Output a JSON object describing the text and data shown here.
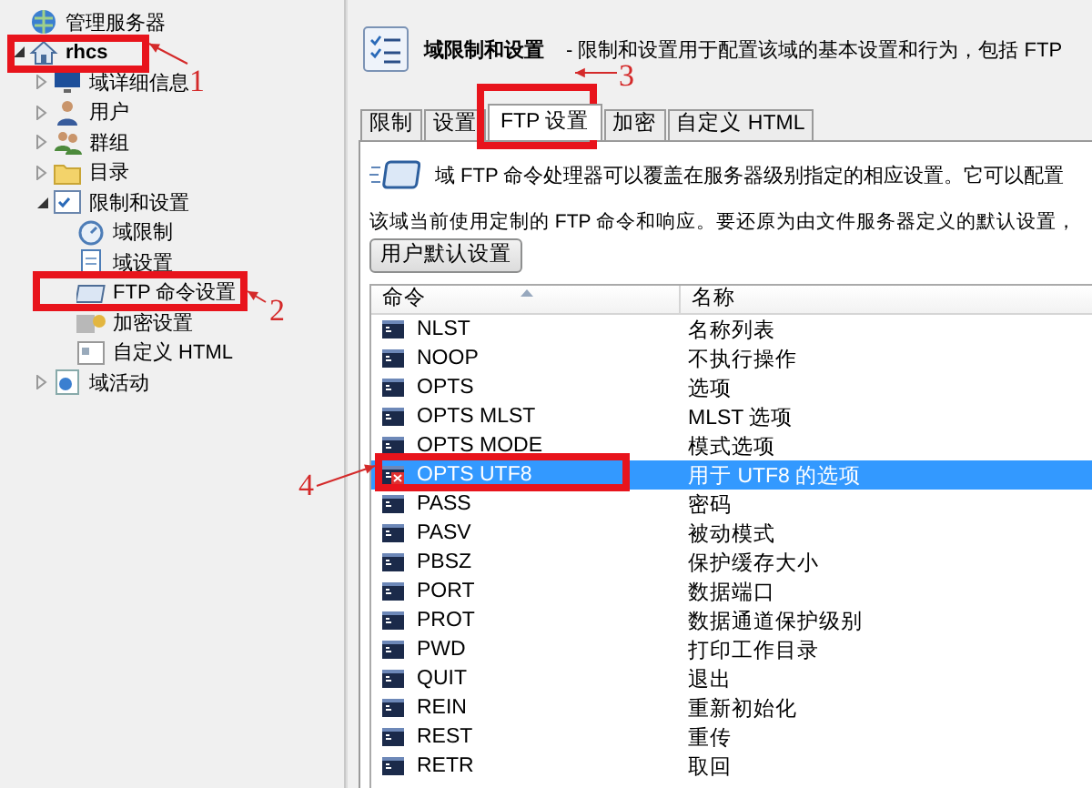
{
  "tree": [
    {
      "label": "管理服务器",
      "children": [
        {
          "label": "rhcs",
          "expanded": true,
          "children": [
            {
              "label": "域详细信息",
              "expanded": false
            },
            {
              "label": "用户",
              "expanded": false
            },
            {
              "label": "群组",
              "expanded": false
            },
            {
              "label": "目录",
              "expanded": false
            },
            {
              "label": "限制和设置",
              "expanded": true,
              "children": [
                {
                  "label": "域限制"
                },
                {
                  "label": "域设置"
                },
                {
                  "label": "FTP 命令设置"
                },
                {
                  "label": "加密设置"
                },
                {
                  "label": "自定义 HTML"
                }
              ]
            },
            {
              "label": "域活动",
              "expanded": false
            }
          ]
        }
      ]
    }
  ],
  "header": {
    "title": "域限制和设置",
    "description": "- 限制和设置用于配置该域的基本设置和行为，包括 FTP"
  },
  "tabs": [
    {
      "label": "限制",
      "selected": false
    },
    {
      "label": "设置",
      "selected": false
    },
    {
      "label": "FTP 设置",
      "selected": true
    },
    {
      "label": "加密",
      "selected": false
    },
    {
      "label": "自定义 HTML",
      "selected": false
    }
  ],
  "info_text": "域 FTP 命令处理器可以覆盖在服务器级别指定的相应设置。它可以配置",
  "status_text": "该域当前使用定制的 FTP 命令和响应。要还原为由文件服务器定义的默认设置，",
  "reset_button": "用户默认设置",
  "table": {
    "columns": [
      "命令",
      "名称"
    ],
    "rows": [
      {
        "command": "NLST",
        "name": "名称列表",
        "selected": false,
        "overridden": false
      },
      {
        "command": "NOOP",
        "name": "不执行操作",
        "selected": false,
        "overridden": false
      },
      {
        "command": "OPTS",
        "name": "选项",
        "selected": false,
        "overridden": false
      },
      {
        "command": "OPTS MLST",
        "name": "MLST 选项",
        "selected": false,
        "overridden": false
      },
      {
        "command": "OPTS MODE",
        "name": "模式选项",
        "selected": false,
        "overridden": false
      },
      {
        "command": "OPTS UTF8",
        "name": "用于 UTF8 的选项",
        "selected": true,
        "overridden": true
      },
      {
        "command": "PASS",
        "name": "密码",
        "selected": false,
        "overridden": false
      },
      {
        "command": "PASV",
        "name": "被动模式",
        "selected": false,
        "overridden": false
      },
      {
        "command": "PBSZ",
        "name": "保护缓存大小",
        "selected": false,
        "overridden": false
      },
      {
        "command": "PORT",
        "name": "数据端口",
        "selected": false,
        "overridden": false
      },
      {
        "command": "PROT",
        "name": "数据通道保护级别",
        "selected": false,
        "overridden": false
      },
      {
        "command": "PWD",
        "name": "打印工作目录",
        "selected": false,
        "overridden": false
      },
      {
        "command": "QUIT",
        "name": "退出",
        "selected": false,
        "overridden": false
      },
      {
        "command": "REIN",
        "name": "重新初始化",
        "selected": false,
        "overridden": false
      },
      {
        "command": "REST",
        "name": "重传",
        "selected": false,
        "overridden": false
      },
      {
        "command": "RETR",
        "name": "取回",
        "selected": false,
        "overridden": false
      }
    ]
  },
  "annotations": [
    {
      "number": "1"
    },
    {
      "number": "2"
    },
    {
      "number": "3"
    },
    {
      "number": "4"
    }
  ]
}
